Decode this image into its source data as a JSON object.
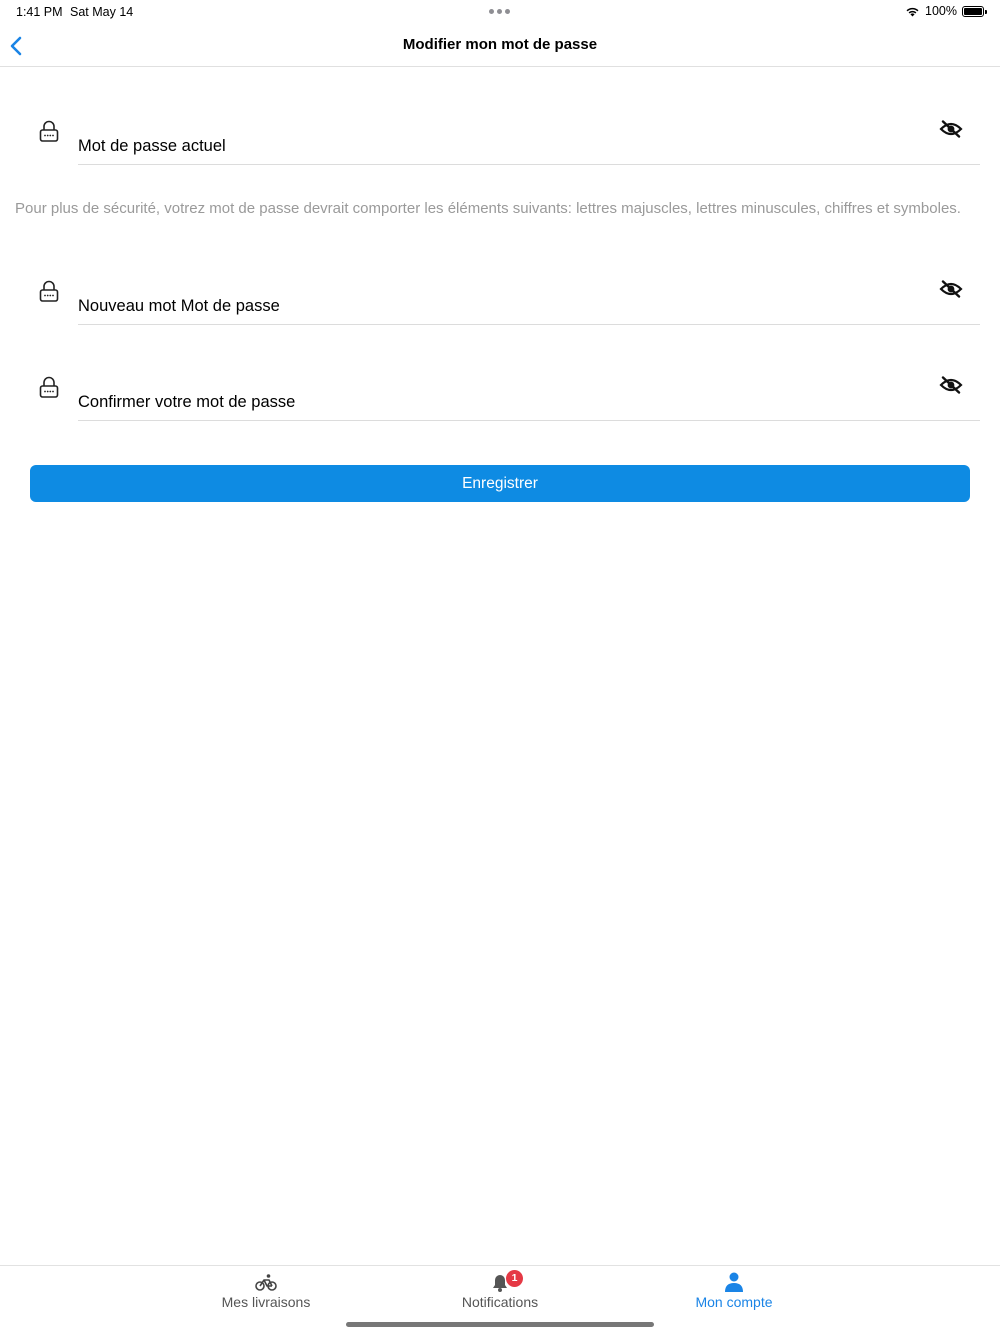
{
  "status_bar": {
    "time": "1:41 PM",
    "date": "Sat May 14",
    "battery": "100%"
  },
  "nav": {
    "title": "Modifier mon mot de passe"
  },
  "fields": {
    "current": {
      "placeholder": "Mot de passe actuel"
    },
    "new": {
      "placeholder": "Nouveau mot Mot de passe"
    },
    "confirm": {
      "placeholder": "Confirmer votre mot de passe"
    }
  },
  "help_text": "Pour plus de sécurité, votrez mot de passe devrait comporter les éléments suivants: lettres majuscles, lettres minuscules, chiffres et symboles.",
  "save_label": "Enregistrer",
  "tabs": [
    {
      "label": "Mes livraisons",
      "icon": "bicycle-icon",
      "active": false
    },
    {
      "label": "Notifications",
      "icon": "bell-icon",
      "badge": "1",
      "active": false
    },
    {
      "label": "Mon compte",
      "icon": "person-icon",
      "active": true
    }
  ],
  "colors": {
    "accent": "#1a84e6",
    "button": "#0e8be3",
    "badge": "#e53945",
    "help_text": "#9a9a9a"
  }
}
